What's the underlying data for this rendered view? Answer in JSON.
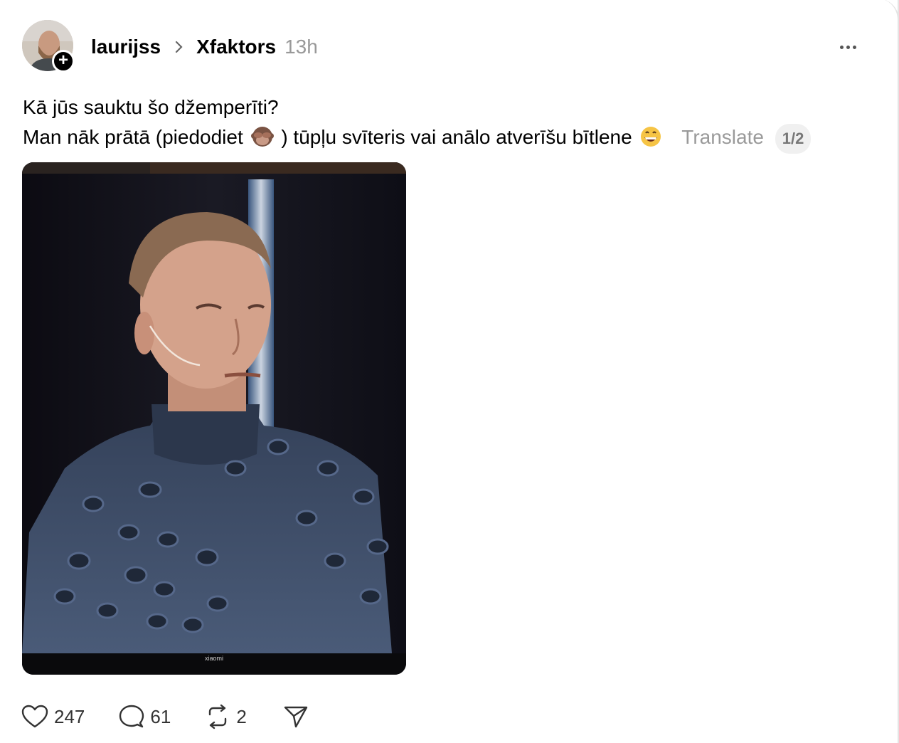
{
  "post": {
    "username": "laurijss",
    "community": "Xfaktors",
    "timestamp": "13h",
    "follow_icon": "plus",
    "text_line1": "Kā jūs sauktu šo džemperīti?",
    "text_line2_a": "Man nāk prātā (piedodiet",
    "text_line2_b": ") tūpļu svīteris vai anālo atverīšu bītlene",
    "emoji_1": "see-no-evil-monkey",
    "emoji_2": "grinning-face",
    "translate_label": "Translate",
    "media_indicator": "1/2",
    "tv_brand": "xiaomi"
  },
  "actions": {
    "likes": "247",
    "replies": "61",
    "reposts": "2"
  },
  "colors": {
    "muted_text": "#999999",
    "primary_text": "#000000",
    "sweater": "#3f4f6b"
  }
}
